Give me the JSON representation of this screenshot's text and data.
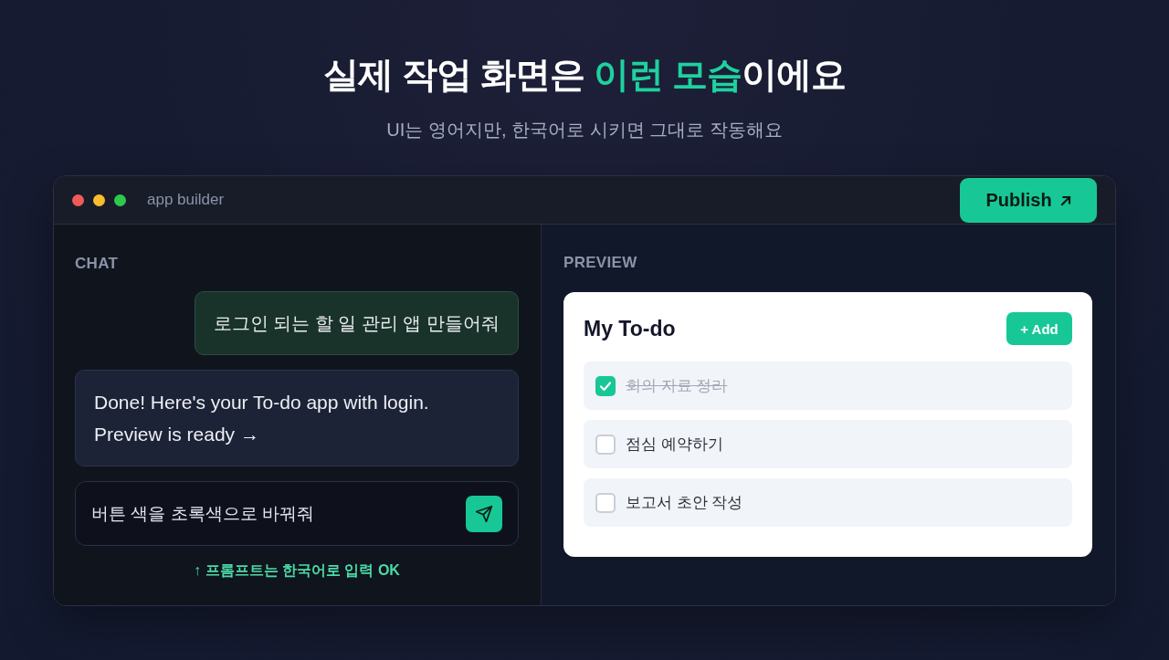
{
  "heading": {
    "parts": [
      {
        "text": "실제 작업 화면은 ",
        "accent": false
      },
      {
        "text": "이런 모습",
        "accent": true
      },
      {
        "text": "이에요",
        "accent": false
      }
    ]
  },
  "subheading": "UI는 영어지만, 한국어로 시키면 그대로 작동해요",
  "window": {
    "controls": [
      {
        "color": "#f25a5a"
      },
      {
        "color": "#fbbd2e"
      },
      {
        "color": "#2ec84a"
      }
    ],
    "title": "app builder",
    "publish_button": {
      "label": "Publish"
    }
  },
  "chat": {
    "label": "CHAT",
    "messages": [
      {
        "kind": "user",
        "text": "로그인 되는 할 일 관리 앱 만들어줘"
      },
      {
        "kind": "assistant",
        "text": "Done! Here's your To-do app with login. Preview is ready →"
      }
    ],
    "input": {
      "value": "버튼 색을 초록색으로 바꿔줘"
    },
    "hint": "↑ 프롬프트는 한국어로 입력 OK"
  },
  "preview": {
    "label": "PREVIEW",
    "card": {
      "title": "My To-do",
      "add_button": "+ Add",
      "todos": [
        {
          "text": "회의 자료 정리",
          "checked": true
        },
        {
          "text": "점심 예약하기",
          "checked": false
        },
        {
          "text": "보고서 초안 작성",
          "checked": false
        }
      ]
    }
  }
}
